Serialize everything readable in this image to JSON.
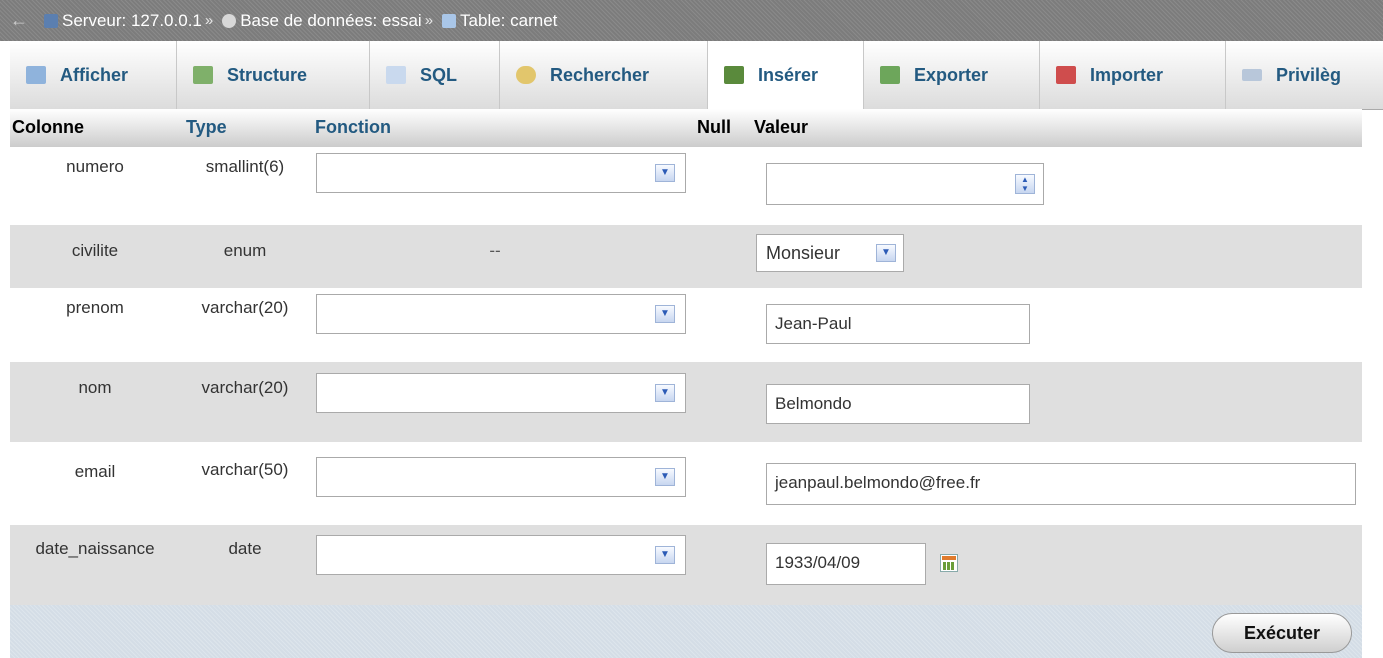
{
  "breadcrumb": {
    "server": "Serveur: 127.0.0.1",
    "database": "Base de données: essai",
    "table": "Table: carnet",
    "separator": "»"
  },
  "tabs": [
    {
      "label": "Afficher",
      "icon": "browse-icon"
    },
    {
      "label": "Structure",
      "icon": "structure-icon"
    },
    {
      "label": "SQL",
      "icon": "sql-icon"
    },
    {
      "label": "Rechercher",
      "icon": "search-icon"
    },
    {
      "label": "Insérer",
      "icon": "insert-icon",
      "active": true
    },
    {
      "label": "Exporter",
      "icon": "export-icon"
    },
    {
      "label": "Importer",
      "icon": "import-icon"
    },
    {
      "label": "Privilèg",
      "icon": "privileges-icon"
    }
  ],
  "header": {
    "column": "Colonne",
    "type": "Type",
    "function": "Fonction",
    "null": "Null",
    "value": "Valeur"
  },
  "rows": [
    {
      "column": "numero",
      "type": "smallint(6)",
      "value": ""
    },
    {
      "column": "civilite",
      "type": "enum",
      "function_placeholder": "--",
      "value": "Monsieur"
    },
    {
      "column": "prenom",
      "type": "varchar(20)",
      "value": "Jean-Paul"
    },
    {
      "column": "nom",
      "type": "varchar(20)",
      "value": "Belmondo"
    },
    {
      "column": "email",
      "type": "varchar(50)",
      "value": "jeanpaul.belmondo@free.fr"
    },
    {
      "column": "date_naissance",
      "type": "date",
      "value": "1933/04/09"
    }
  ],
  "footer": {
    "execute_label": "Exécuter"
  }
}
